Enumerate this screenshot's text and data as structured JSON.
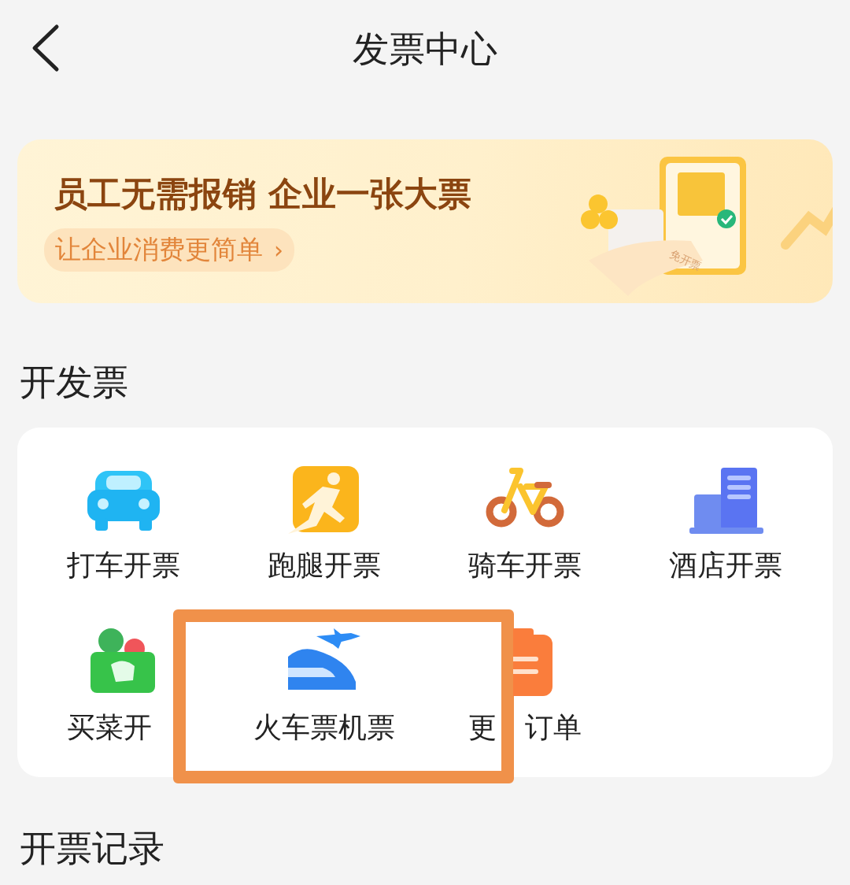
{
  "header": {
    "title": "发票中心"
  },
  "banner": {
    "headline": "员工无需报销 企业一张大票",
    "link": "让企业消费更简单",
    "link_arrow": "›",
    "illustration_text": "免开票"
  },
  "invoice_section": {
    "title": "开发票",
    "items": [
      {
        "label": "打车开票",
        "highlighted": false
      },
      {
        "label": "跑腿开票",
        "highlighted": false
      },
      {
        "label": "骑车开票",
        "highlighted": false
      },
      {
        "label": "酒店开票",
        "highlighted": false
      },
      {
        "label": "买菜开",
        "highlighted": false
      },
      {
        "label": "火车票机票",
        "highlighted": true
      },
      {
        "label_parts": [
          "更",
          "订单"
        ],
        "highlighted": false
      }
    ]
  },
  "records_section": {
    "title": "开票记录"
  }
}
